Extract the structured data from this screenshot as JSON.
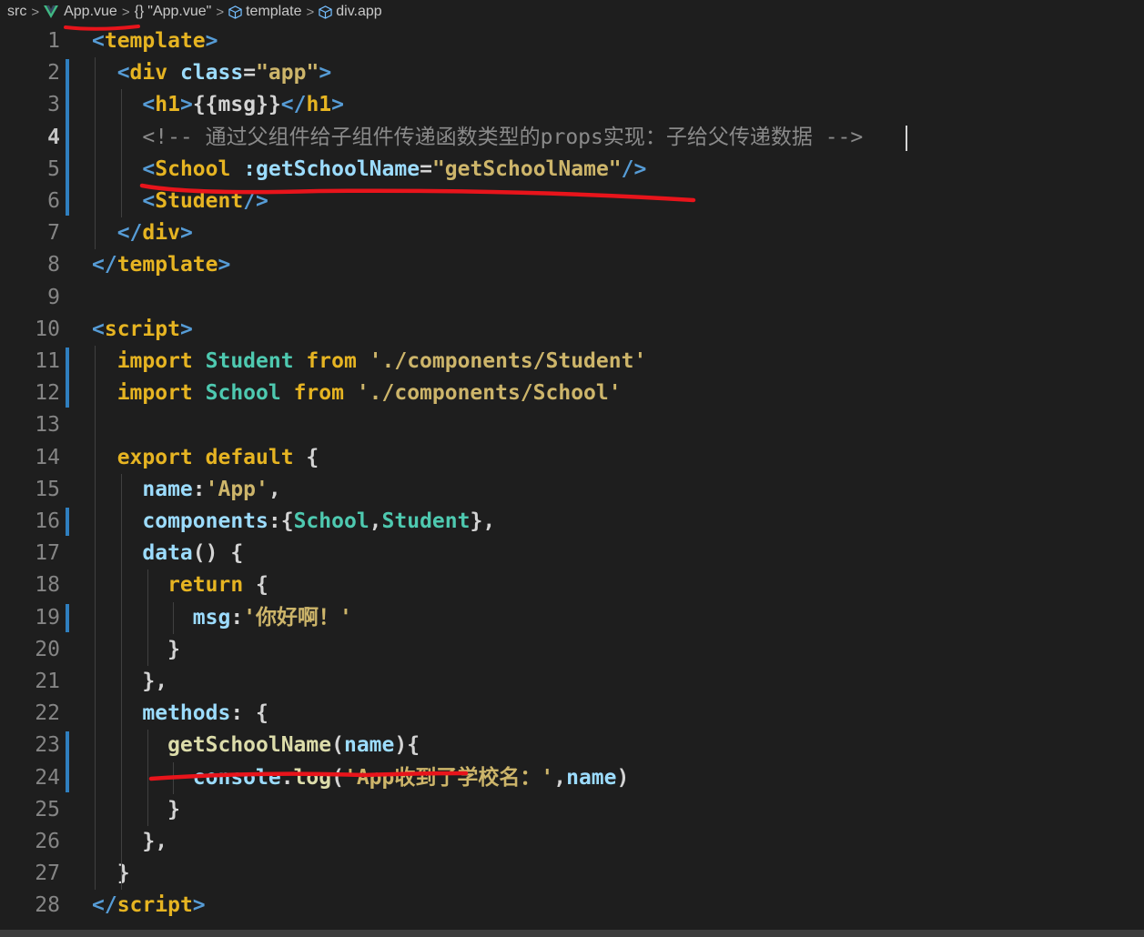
{
  "breadcrumb": {
    "items": [
      {
        "label": "src",
        "icon": ""
      },
      {
        "label": "App.vue",
        "icon": "vue-icon"
      },
      {
        "label": "\"App.vue\"",
        "icon": "braces-icon"
      },
      {
        "label": "template",
        "icon": "cube-icon"
      },
      {
        "label": "div.app",
        "icon": "cube-icon"
      }
    ],
    "separator": ">"
  },
  "editor": {
    "active_line": 4,
    "line_numbers": [
      "1",
      "2",
      "3",
      "4",
      "5",
      "6",
      "7",
      "8",
      "9",
      "10",
      "11",
      "12",
      "13",
      "14",
      "15",
      "16",
      "17",
      "18",
      "19",
      "20",
      "21",
      "22",
      "23",
      "24",
      "25",
      "26",
      "27",
      "28"
    ],
    "lines": [
      [
        {
          "c": "tag",
          "t": "<"
        },
        {
          "c": "tagname",
          "t": "template"
        },
        {
          "c": "tag",
          "t": ">"
        }
      ],
      [
        {
          "c": "tag",
          "t": "  <"
        },
        {
          "c": "tagname",
          "t": "div"
        },
        {
          "c": "punct",
          "t": " "
        },
        {
          "c": "attr",
          "t": "class"
        },
        {
          "c": "punct",
          "t": "="
        },
        {
          "c": "str2",
          "t": "\"app\""
        },
        {
          "c": "tag",
          "t": ">"
        }
      ],
      [
        {
          "c": "tag",
          "t": "    <"
        },
        {
          "c": "tagname",
          "t": "h1"
        },
        {
          "c": "tag",
          "t": ">"
        },
        {
          "c": "punct",
          "t": "{{msg}}"
        },
        {
          "c": "tag",
          "t": "</"
        },
        {
          "c": "tagname",
          "t": "h1"
        },
        {
          "c": "tag",
          "t": ">"
        }
      ],
      [
        {
          "c": "comment",
          "t": "    <!-- 通过父组件给子组件传递函数类型的props实现：子给父传递数据 -->"
        }
      ],
      [
        {
          "c": "tag",
          "t": "    <"
        },
        {
          "c": "tagname",
          "t": "School"
        },
        {
          "c": "punct",
          "t": " "
        },
        {
          "c": "attr",
          "t": ":getSchoolName"
        },
        {
          "c": "punct",
          "t": "="
        },
        {
          "c": "str2",
          "t": "\"getSchoolName\""
        },
        {
          "c": "tag",
          "t": "/>"
        }
      ],
      [
        {
          "c": "tag",
          "t": "    <"
        },
        {
          "c": "tagname",
          "t": "Student"
        },
        {
          "c": "tag",
          "t": "/>"
        }
      ],
      [
        {
          "c": "tag",
          "t": "  </"
        },
        {
          "c": "tagname",
          "t": "div"
        },
        {
          "c": "tag",
          "t": ">"
        }
      ],
      [
        {
          "c": "tag",
          "t": "</"
        },
        {
          "c": "tagname",
          "t": "template"
        },
        {
          "c": "tag",
          "t": ">"
        }
      ],
      [],
      [
        {
          "c": "tag",
          "t": "<"
        },
        {
          "c": "tagname",
          "t": "script"
        },
        {
          "c": "tag",
          "t": ">"
        }
      ],
      [
        {
          "c": "kw",
          "t": "  import "
        },
        {
          "c": "cls",
          "t": "Student "
        },
        {
          "c": "kw",
          "t": "from "
        },
        {
          "c": "str2",
          "t": "'./components/Student'"
        }
      ],
      [
        {
          "c": "kw",
          "t": "  import "
        },
        {
          "c": "cls",
          "t": "School "
        },
        {
          "c": "kw",
          "t": "from "
        },
        {
          "c": "str2",
          "t": "'./components/School'"
        }
      ],
      [],
      [
        {
          "c": "kw",
          "t": "  export default "
        },
        {
          "c": "punct",
          "t": "{"
        }
      ],
      [
        {
          "c": "prop",
          "t": "    name"
        },
        {
          "c": "punct",
          "t": ":"
        },
        {
          "c": "str2",
          "t": "'App'"
        },
        {
          "c": "punct",
          "t": ","
        }
      ],
      [
        {
          "c": "prop",
          "t": "    components"
        },
        {
          "c": "punct",
          "t": ":{"
        },
        {
          "c": "cls",
          "t": "School"
        },
        {
          "c": "punct",
          "t": ","
        },
        {
          "c": "cls",
          "t": "Student"
        },
        {
          "c": "punct",
          "t": "},"
        }
      ],
      [
        {
          "c": "prop",
          "t": "    data"
        },
        {
          "c": "punct",
          "t": "() {"
        }
      ],
      [
        {
          "c": "kw",
          "t": "      return "
        },
        {
          "c": "punct",
          "t": "{"
        }
      ],
      [
        {
          "c": "prop",
          "t": "        msg"
        },
        {
          "c": "punct",
          "t": ":"
        },
        {
          "c": "str2",
          "t": "'你好啊！'"
        }
      ],
      [
        {
          "c": "punct",
          "t": "      }"
        }
      ],
      [
        {
          "c": "punct",
          "t": "    },"
        }
      ],
      [
        {
          "c": "prop",
          "t": "    methods"
        },
        {
          "c": "punct",
          "t": ": {"
        }
      ],
      [
        {
          "c": "fn",
          "t": "      getSchoolName"
        },
        {
          "c": "punct",
          "t": "("
        },
        {
          "c": "param",
          "t": "name"
        },
        {
          "c": "punct",
          "t": "){"
        }
      ],
      [
        {
          "c": "prop",
          "t": "        console"
        },
        {
          "c": "punct",
          "t": "."
        },
        {
          "c": "fn",
          "t": "log"
        },
        {
          "c": "punct",
          "t": "("
        },
        {
          "c": "str2",
          "t": "'App收到了学校名：'"
        },
        {
          "c": "punct",
          "t": ","
        },
        {
          "c": "param",
          "t": "name"
        },
        {
          "c": "punct",
          "t": ")"
        }
      ],
      [
        {
          "c": "punct",
          "t": "      }"
        }
      ],
      [
        {
          "c": "punct",
          "t": "    },"
        }
      ],
      [
        {
          "c": "punct",
          "t": "  }"
        }
      ],
      [
        {
          "c": "tag",
          "t": "</"
        },
        {
          "c": "tagname",
          "t": "script"
        },
        {
          "c": "tag",
          "t": ">"
        }
      ]
    ]
  },
  "colors": {
    "background": "#1e1e1e",
    "tag_bracket": "#569cd6",
    "tag_name": "#e6b422",
    "attribute": "#9cdcfe",
    "string": "#cdb56a",
    "keyword": "#e6b422",
    "class_name": "#4ec9b0",
    "comment": "#8a8a8a",
    "annotation_red": "#e8141b"
  }
}
